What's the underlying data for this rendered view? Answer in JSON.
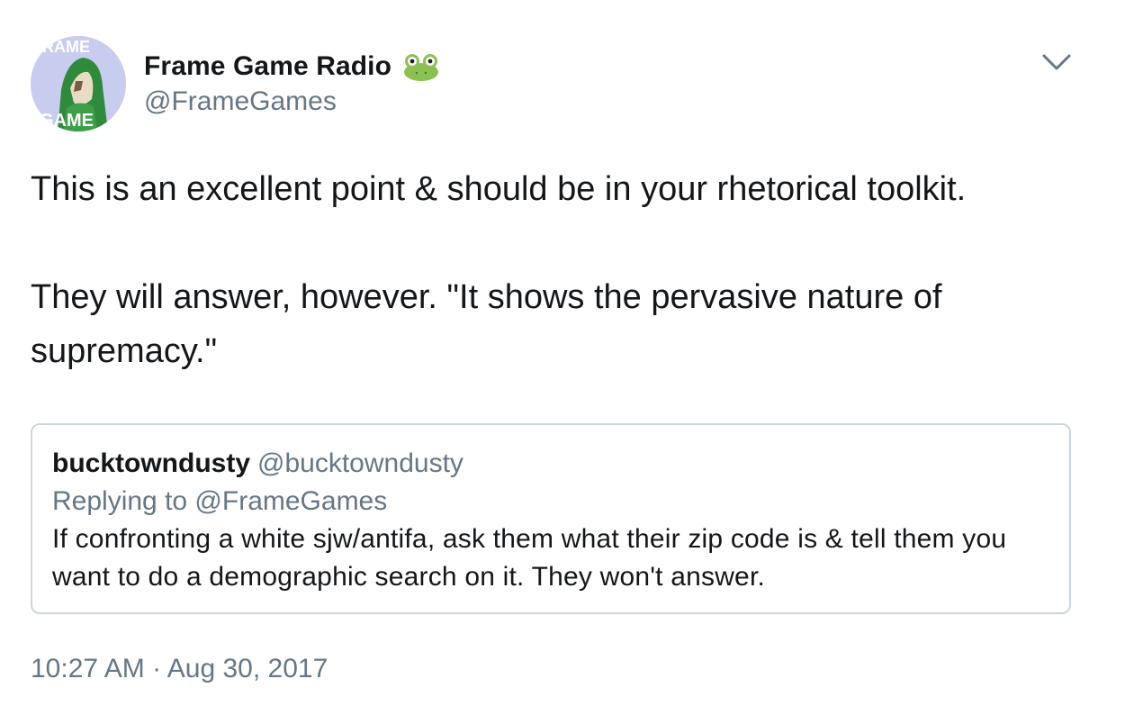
{
  "author": {
    "name": "Frame Game Radio",
    "handle": "@FrameGames",
    "avatar_text_top": "FRAME",
    "avatar_text_bottom": "GAME",
    "name_emoji": "frog-icon"
  },
  "menu": {
    "icon": "chevron-down-icon"
  },
  "tweet": {
    "paragraphs": [
      "This is an excellent point & should be in your rhetorical toolkit.",
      "They will answer, however. \"It shows the pervasive nature of supremacy.\""
    ]
  },
  "quoted_tweet": {
    "name": "bucktowndusty",
    "handle": "@bucktowndusty",
    "replying_to": "Replying to @FrameGames",
    "text": "If confronting a white sjw/antifa, ask them what their zip code is & tell them you want to do a demographic search on it. They won't answer."
  },
  "timestamp": "10:27 AM · Aug 30, 2017",
  "colors": {
    "primary_text": "#14171a",
    "secondary_text": "#657786",
    "border": "#ccd6dd",
    "frog_green": "#8cc152"
  }
}
